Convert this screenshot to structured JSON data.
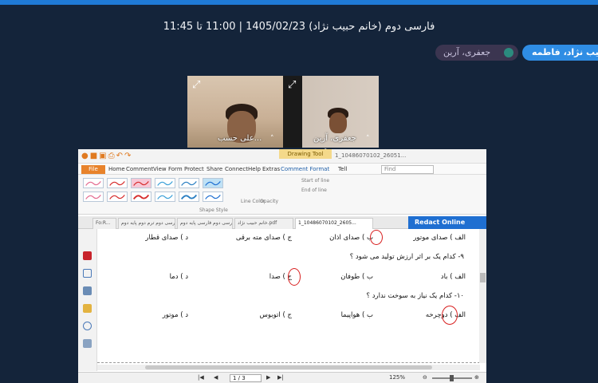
{
  "header": {
    "title": "فارسی دوم (خانم حبیب نژاد) 1405/02/23 | 11:00 تا 11:45"
  },
  "participants": {
    "host_chip": "حبیب نژاد، فاطمه",
    "user_chip": "جعفری، آرین"
  },
  "video_tiles": [
    {
      "name": "علی حسب...",
      "chevron": "˄",
      "expand": "⤢"
    },
    {
      "name": "جعفری، آرین",
      "chevron": "˄",
      "expand": "⤢"
    }
  ],
  "app": {
    "drawing_tool_label": "Drawing Tool",
    "doc_title": "1_10486070102_26051...",
    "file_button": "File",
    "menus": [
      "Home",
      "Comment",
      "View",
      "Form",
      "Protect",
      "Share",
      "Connect",
      "Help",
      "Extras",
      "Comment Format"
    ],
    "tell_me": "Tell",
    "find_placeholder": "Find",
    "ribbon": {
      "shape_style_label": "Shape Style",
      "line_color": "Line Color",
      "opacity": "Opacity",
      "start_of_line": "Start of line",
      "end_of_line": "End of line"
    },
    "doc_tabs": [
      "Fo:R...",
      "فارسی دوم ترم دوم پایه دوم",
      "فارسی دوم فارسی پایه دوم",
      "خانم حبیب نژاد.pdf",
      "1_10486070102_2605..."
    ],
    "redact_label": "Redact Online",
    "page_nav": "1 / 3",
    "zoom": "125%",
    "colors": {
      "accent": "#1f6fd1",
      "file_btn": "#e8832b",
      "circle": "#d81f1f"
    }
  },
  "document": {
    "lines": [
      {
        "a": "الف ) صدای موتور",
        "b": "ب ) صدای اذان",
        "c": "ج ) صدای مته برقی",
        "d": "د ) صدای قطار"
      },
      {
        "q": "۹- کدام یک بر اثر ارزش تولید می شود ؟"
      },
      {
        "a": "الف ) باد",
        "b": "ب ) طوفان",
        "c": "ج ) صدا",
        "d": "د ) دما"
      },
      {
        "q": "۱۰- کدام یک نیاز به سوخت ندارد ؟"
      },
      {
        "a": "الف ) دوچرخه",
        "b": "ب ) هواپیما",
        "c": "ج ) اتوبوس",
        "d": "د ) موتور"
      }
    ]
  }
}
